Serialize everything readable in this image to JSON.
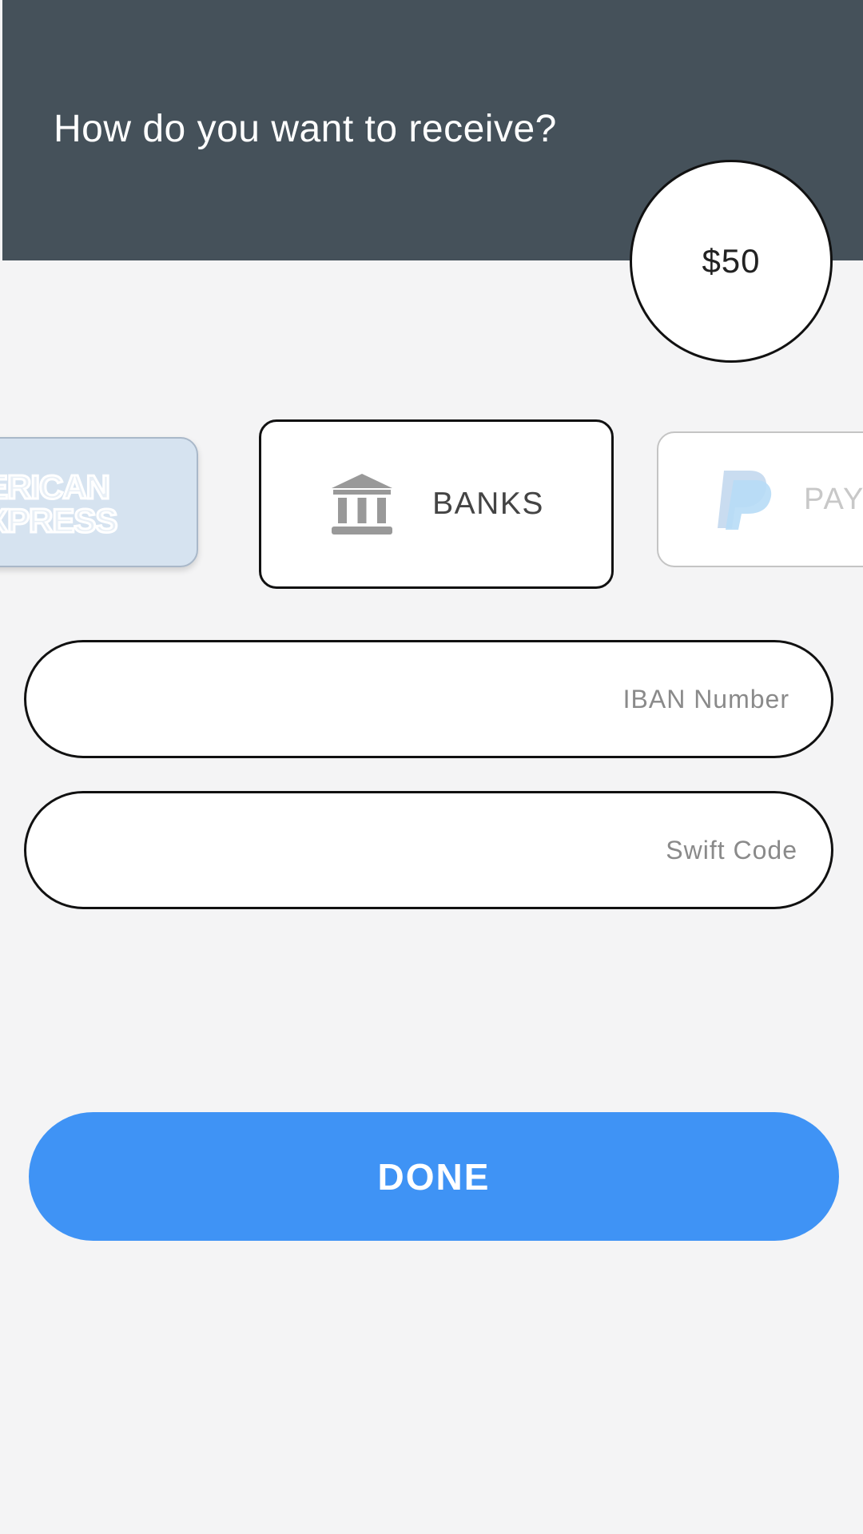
{
  "header": {
    "title": "How do you want to receive?",
    "background_color": "#45515a"
  },
  "amount": {
    "value": "$50"
  },
  "payment_methods": [
    {
      "id": "amex",
      "label": "AMERICAN\nEXPRESS",
      "visible_text": "ERICAN\nXPRESS",
      "icon": "american-express-logo",
      "selected": false
    },
    {
      "id": "banks",
      "label": "BANKS",
      "icon": "bank-icon",
      "selected": true
    },
    {
      "id": "paypal",
      "label": "PAY",
      "icon": "paypal-logo",
      "selected": false
    }
  ],
  "form": {
    "iban": {
      "placeholder": "IBAN Number",
      "value": ""
    },
    "swift": {
      "placeholder": "Swift Code",
      "value": ""
    }
  },
  "actions": {
    "done_label": "DONE",
    "done_color": "#3f93f5"
  }
}
